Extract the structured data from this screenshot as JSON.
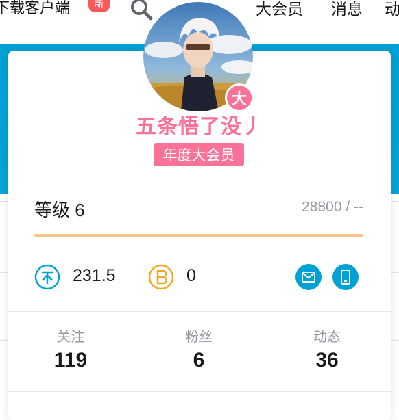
{
  "topbar": {
    "download_label": "下载客户端",
    "new_badge": "新",
    "nav": [
      "大会员",
      "消息",
      "动"
    ]
  },
  "profile": {
    "username": "五条悟了没丿",
    "vip_badge": "大",
    "vip_tag": "年度大会员",
    "level_label": "等级 6",
    "exp_text": "28800 / --",
    "exp_progress": 1.0
  },
  "wallet": {
    "coins": "231.5",
    "bcoins": "0"
  },
  "stats": [
    {
      "label": "关注",
      "value": "119"
    },
    {
      "label": "粉丝",
      "value": "6"
    },
    {
      "label": "动态",
      "value": "36"
    }
  ],
  "colors": {
    "brand_blue": "#00a1d6",
    "brand_pink": "#fb7299",
    "bcoin_orange": "#f5a623",
    "exp_bar": "#f8c68a"
  },
  "icons": {
    "coin": "coin-icon",
    "bcoin": "bcoin-icon",
    "mail": "mail-icon",
    "phone": "phone-icon",
    "search": "search-icon"
  }
}
